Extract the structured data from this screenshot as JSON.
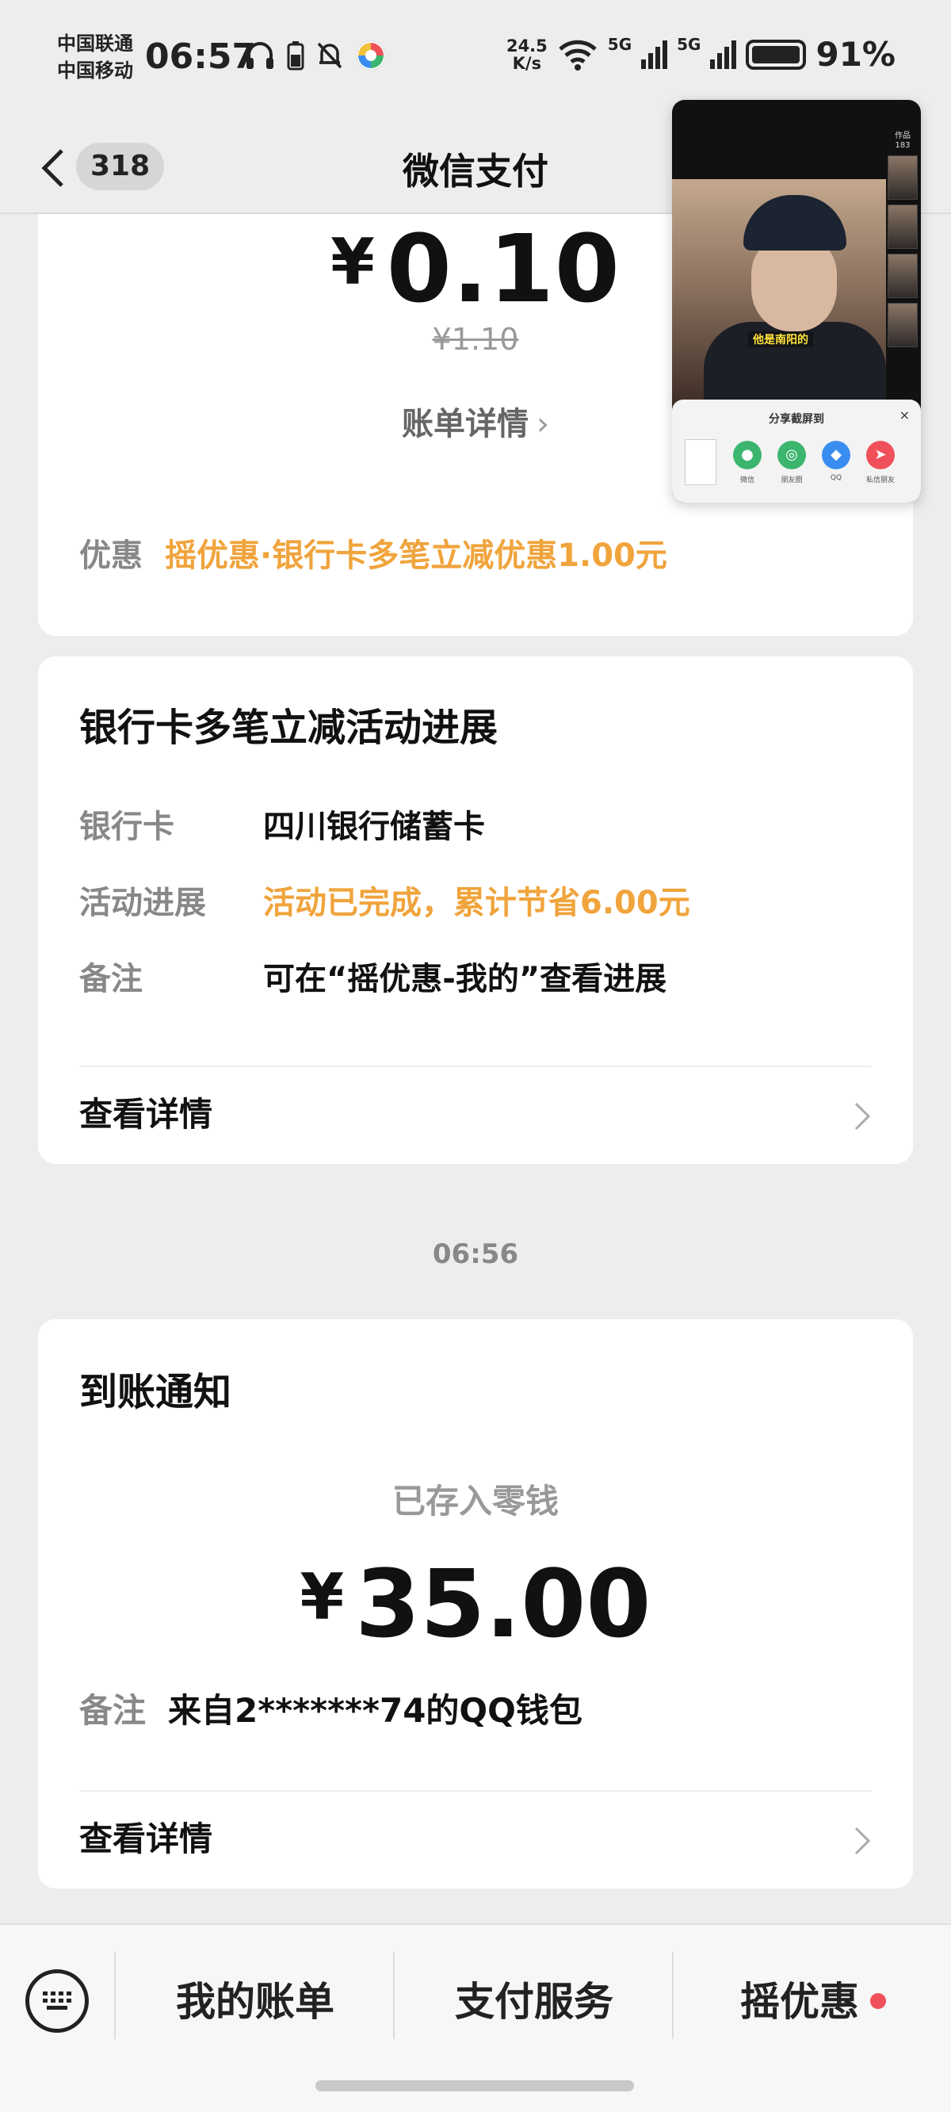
{
  "status_bar": {
    "carrier1": "中国联通",
    "carrier2": "中国移动",
    "time": "06:57",
    "speed_value": "24.5",
    "speed_unit": "K/s",
    "sig1": "5G",
    "sig2": "5G",
    "battery_pct": "91%"
  },
  "nav": {
    "unread_count": "318",
    "title": "微信支付"
  },
  "payment_card": {
    "currency_symbol": "¥",
    "amount": "0.10",
    "original_amount": "¥1.10",
    "bill_details_label": "账单详情",
    "discount_label": "优惠",
    "discount_value": "摇优惠·银行卡多笔立减优惠1.00元"
  },
  "progress_card": {
    "title": "银行卡多笔立减活动进展",
    "bank_card_label": "银行卡",
    "bank_card_value": "四川银行储蓄卡",
    "progress_label": "活动进展",
    "progress_value": "活动已完成，累计节省6.00元",
    "note_label": "备注",
    "note_value": "可在“摇优惠-我的”查看进展",
    "detail_label": "查看详情"
  },
  "timestamp": "06:56",
  "arrival_card": {
    "title": "到账通知",
    "status": "已存入零钱",
    "currency_symbol": "¥",
    "amount": "35.00",
    "note_label": "备注",
    "note_value": "来自2*******74的QQ钱包",
    "detail_label": "查看详情"
  },
  "bottom_menu": {
    "item1": "我的账单",
    "item2": "支付服务",
    "item3": "摇优惠"
  },
  "floating_video": {
    "subtitle": "他是南阳的",
    "works_label": "作品",
    "works_count": "183",
    "share_title": "分享截屏到",
    "share_close": "×",
    "share_targets": [
      "微信",
      "朋友圈",
      "QQ",
      "私信朋友"
    ]
  },
  "colors": {
    "accent_orange": "#f0a43c",
    "background": "#ededed",
    "red_dot": "#f0505a"
  }
}
